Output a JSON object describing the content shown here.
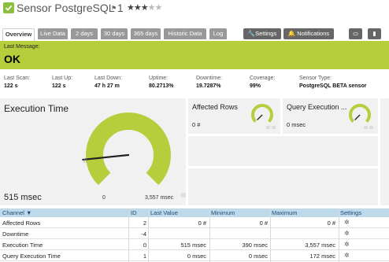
{
  "header": {
    "title": "Sensor PostgreSQL 1",
    "flag_icon": "flag-icon",
    "stars_filled": 3,
    "stars_total": 5
  },
  "tabs": [
    "Overview",
    "Live Data",
    "2 days",
    "30 days",
    "365 days",
    "Historic Data",
    "Log"
  ],
  "actions": {
    "settings": "Settings",
    "notifications": "Notifications"
  },
  "status": {
    "label": "Last Message:",
    "message": "OK",
    "color": "#b7ce3c"
  },
  "stats": [
    {
      "label": "Last Scan:",
      "value": "122 s"
    },
    {
      "label": "Last Up:",
      "value": "122 s"
    },
    {
      "label": "Last Down:",
      "value": "47 h 27 m"
    },
    {
      "label": "Uptime:",
      "value": "80.2713%"
    },
    {
      "label": "Downtime:",
      "value": "19.7287%"
    },
    {
      "label": "Coverage:",
      "value": "99%"
    },
    {
      "label": "Sensor Type:",
      "value": "PostgreSQL BETA sensor"
    }
  ],
  "gauges": {
    "main": {
      "title": "Execution Time",
      "value": "515 msec",
      "min": "0",
      "max": "3,557 msec",
      "fraction": 0.145
    },
    "affected": {
      "title": "Affected Rows",
      "value": "0 #",
      "fraction": 0.0
    },
    "query": {
      "title": "Query Execution ...",
      "value": "0 msec",
      "fraction": 0.0
    }
  },
  "table": {
    "headers": [
      "Channel",
      "ID",
      "Last Value",
      "Minimum",
      "Maximum",
      "Settings"
    ],
    "rows": [
      {
        "channel": "Affected Rows",
        "id": "2",
        "last": "0 #",
        "min": "0 #",
        "max": "0 #"
      },
      {
        "channel": "Downtime",
        "id": "-4",
        "last": "",
        "min": "",
        "max": ""
      },
      {
        "channel": "Execution Time",
        "id": "0",
        "last": "515 msec",
        "min": "390 msec",
        "max": "3,557 msec"
      },
      {
        "channel": "Query Execution Time",
        "id": "1",
        "last": "0 msec",
        "min": "0 msec",
        "max": "172 msec"
      }
    ]
  },
  "colors": {
    "accent": "#8cbf3f",
    "gauge": "#b7ce3c",
    "header_blue": "#bed9e9"
  }
}
